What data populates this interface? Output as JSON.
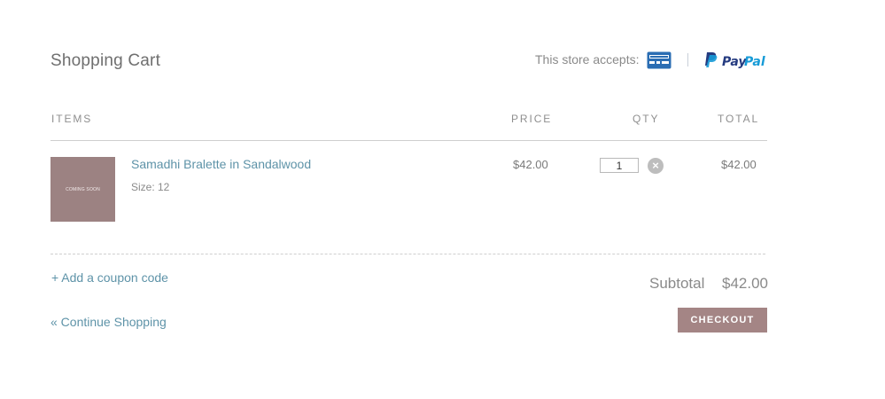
{
  "cart": {
    "title": "Shopping Cart"
  },
  "payments": {
    "accepts_label": "This store accepts:",
    "card_icon": "credit-card-icon",
    "paypal_logo_text": "PayPal",
    "paypal_colors": {
      "dark": "#253b80",
      "light": "#179bd7"
    },
    "card_color": "#2a6db3"
  },
  "columns": {
    "items": "ITEMS",
    "price": "PRICE",
    "qty": "QTY",
    "total": "TOTAL"
  },
  "line_items": [
    {
      "thumbnail_text": "COMING SOON",
      "name": "Samadhi Bralette in Sandalwood",
      "size": "Size: 12",
      "price": "$42.00",
      "quantity": "1",
      "remove_icon": "remove-circle-icon",
      "total": "$42.00"
    }
  ],
  "coupon": {
    "label": "+ Add a coupon code"
  },
  "summary": {
    "subtotal_label": "Subtotal",
    "subtotal_value": "$42.00"
  },
  "actions": {
    "continue_label": "« Continue Shopping",
    "checkout_label": "CHECKOUT"
  },
  "colors": {
    "link": "#5e93a8",
    "checkout_bg": "#a48585",
    "thumbnail_bg": "#9c8282"
  }
}
